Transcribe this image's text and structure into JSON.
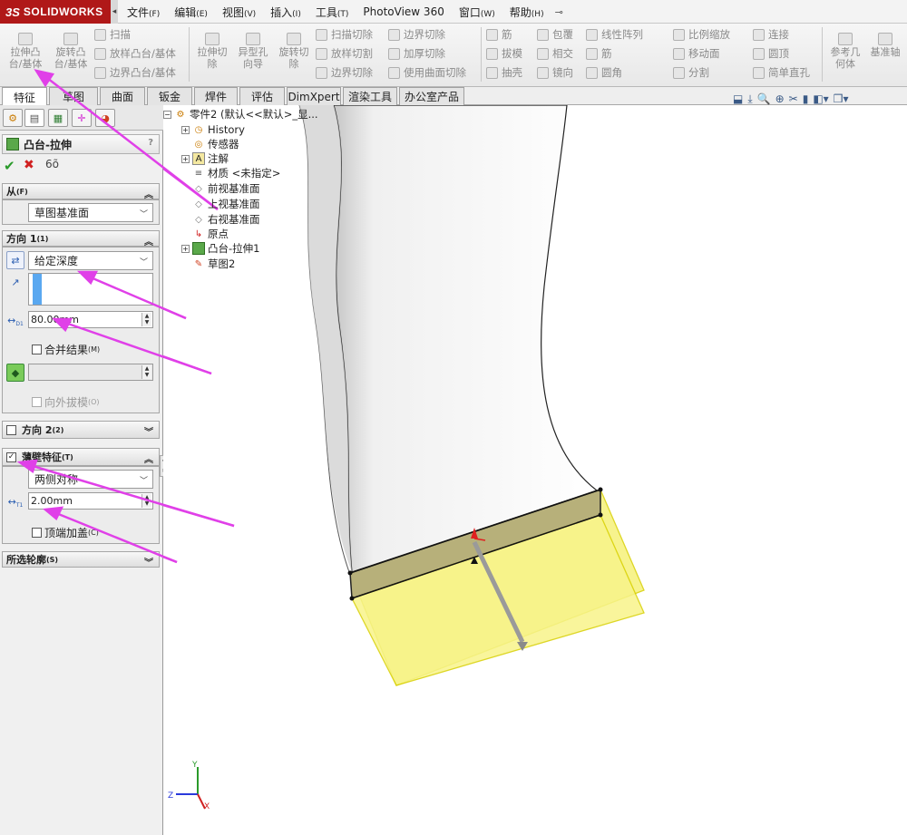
{
  "app": {
    "logo_ds": "3S",
    "logo_name": "SOLIDWORKS",
    "logo_arrow": "◂"
  },
  "menu": [
    {
      "label": "文件",
      "key": "(F)"
    },
    {
      "label": "编辑",
      "key": "(E)"
    },
    {
      "label": "视图",
      "key": "(V)"
    },
    {
      "label": "插入",
      "key": "(I)"
    },
    {
      "label": "工具",
      "key": "(T)"
    },
    {
      "label": "PhotoView 360",
      "key": ""
    },
    {
      "label": "窗口",
      "key": "(W)"
    },
    {
      "label": "帮助",
      "key": "(H)"
    }
  ],
  "ribbon": {
    "extrude_boss": "拉伸凸\n台/基体",
    "revolve_boss": "旋转凸\n台/基体",
    "sweep": "扫描",
    "loft_boss": "放样凸台/基体",
    "boundary_boss": "边界凸台/基体",
    "extrude_cut": "拉伸切\n除",
    "hole_wizard": "异型孔\n向导",
    "revolve_cut": "旋转切\n除",
    "swept_cut": "扫描切除",
    "lofted_cut": "放样切割",
    "boundary_cut": "边界切除",
    "boundary_cut2": "边界切除",
    "thicken_cut": "加厚切除",
    "surface_cut": "使用曲面切除",
    "rib": "筋",
    "draft": "拔模",
    "shell": "抽壳",
    "wrap": "包覆",
    "intersect": "相交",
    "mirror": "镜向",
    "linear_pattern": "线性阵列",
    "rib2": "筋",
    "fillet": "圆角",
    "scale": "比例缩放",
    "move_face": "移动面",
    "split": "分割",
    "connect": "连接",
    "dome": "圆顶",
    "simple_hole": "简单直孔",
    "ref_geometry": "参考几\n何体",
    "datum_axis": "基准轴"
  },
  "tabs": [
    "特征",
    "草图",
    "曲面",
    "钣金",
    "焊件",
    "评估",
    "DimXpert",
    "渲染工具",
    "办公室产品"
  ],
  "panel": {
    "title": "凸台-拉伸",
    "help": "?",
    "ok": "✔",
    "cancel": "✖",
    "preview": "6õ",
    "from_label": "从",
    "from_key": "(F)",
    "from_value": "草图基准面",
    "dir1_label": "方向 1",
    "dir1_key": "(1)",
    "end_condition": "给定深度",
    "depth_value": "80.00mm",
    "merge_result": "合并结果",
    "merge_key": "(M)",
    "draft_outward": "向外拔模",
    "draft_key": "(O)",
    "dir2_label": "方向 2",
    "dir2_key": "(2)",
    "thin_label": "薄壁特征",
    "thin_key": "(T)",
    "thin_type": "两侧对称",
    "thin_value": "2.00mm",
    "cap_ends": "顶端加盖",
    "cap_key": "(C)",
    "contours_label": "所选轮廓",
    "contours_key": "(S)",
    "d1_sub": "D1",
    "t1_sub": "T1"
  },
  "tree": {
    "root": "零件2 (默认<<默认>_显...",
    "items": [
      "History",
      "传感器",
      "注解",
      "材质 <未指定>",
      "前视基准面",
      "上视基准面",
      "右视基准面",
      "原点",
      "凸台-拉伸1",
      "草图2"
    ]
  },
  "triad": {
    "x": "X",
    "y": "Y",
    "z": "Z"
  },
  "colors": {
    "annotation_arrow": "#e040e8",
    "preview_fill": "#f6f27a",
    "preview_edge": "#d8d000",
    "menubar": "#f3f3f3",
    "logo": "#b01818"
  }
}
